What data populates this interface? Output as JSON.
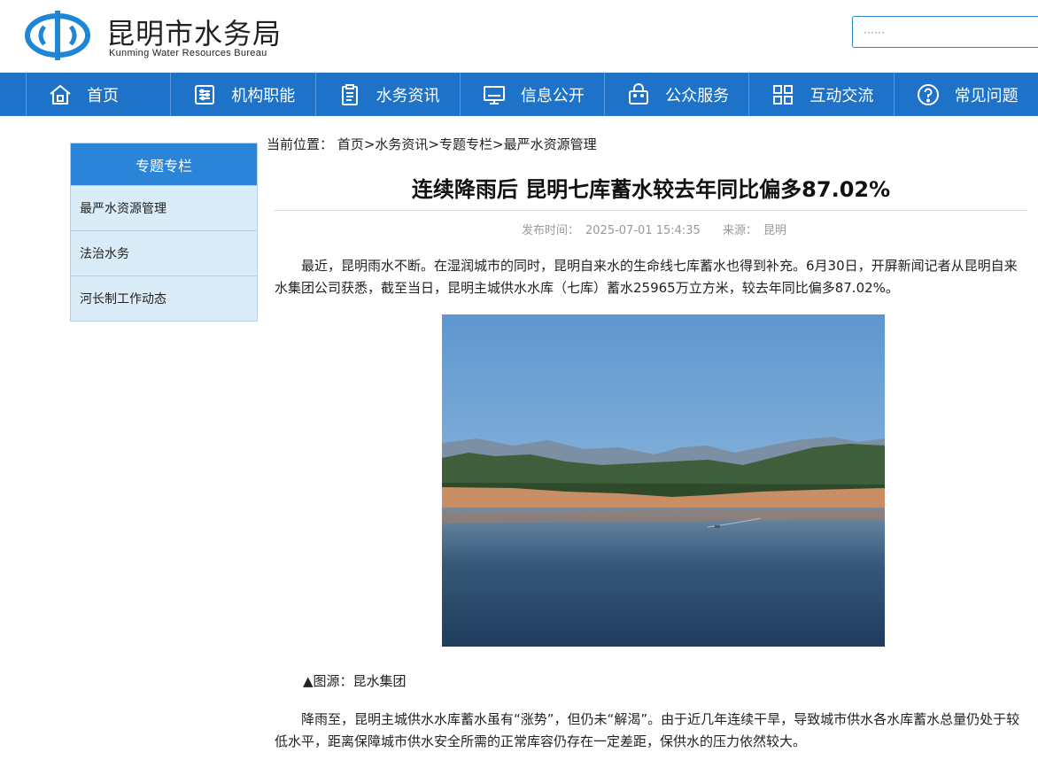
{
  "header": {
    "site_title": "昆明市水务局",
    "site_subtitle": "Kunming Water Resources Bureau",
    "search_placeholder": "······"
  },
  "nav": {
    "items": [
      {
        "label": "首页",
        "icon": "home-icon"
      },
      {
        "label": "机构职能",
        "icon": "settings-sliders-icon"
      },
      {
        "label": "水务资讯",
        "icon": "clipboard-icon"
      },
      {
        "label": "信息公开",
        "icon": "monitor-icon"
      },
      {
        "label": "公众服务",
        "icon": "bag-icon"
      },
      {
        "label": "互动交流",
        "icon": "grid-icon"
      },
      {
        "label": "常见问题",
        "icon": "question-icon"
      }
    ]
  },
  "sidebar": {
    "heading": "专题专栏",
    "items": [
      {
        "label": "最严水资源管理"
      },
      {
        "label": "法治水务"
      },
      {
        "label": "河长制工作动态"
      }
    ]
  },
  "breadcrumb": {
    "prefix": "当前位置：",
    "items": [
      "首页",
      "水务资讯",
      "专题专栏",
      "最严水资源管理"
    ],
    "separator": ">"
  },
  "article": {
    "title": "连续降雨后 昆明七库蓄水较去年同比偏多87.02%",
    "publish_label": "发布时间：",
    "publish_time": "2025-07-01 15:4:35",
    "source_label": "来源：",
    "source": "昆明",
    "paragraph1": "最近，昆明雨水不断。在湿润城市的同时，昆明自来水的生命线七库蓄水也得到补充。6月30日，开屏新闻记者从昆明自来水集团公司获悉，截至当日，昆明主城供水水库（七库）蓄水25965万立方米，较去年同比偏多87.02%。",
    "caption": "▲图源：昆水集团",
    "paragraph2": "降雨至，昆明主城供水水库蓄水虽有“涨势”，但仍未“解渴”。由于近几年连续干旱，导致城市供水各水库蓄水总量仍处于较低水平，距离保障城市供水安全所需的正常库容仍存在一定差距，保供水的压力依然较大。"
  },
  "colors": {
    "nav_bg": "#1e73c8",
    "sidebar_head_bg": "#2a85d8",
    "sidebar_bg": "#d9ecf7",
    "logo_blue": "#1f86d6"
  }
}
